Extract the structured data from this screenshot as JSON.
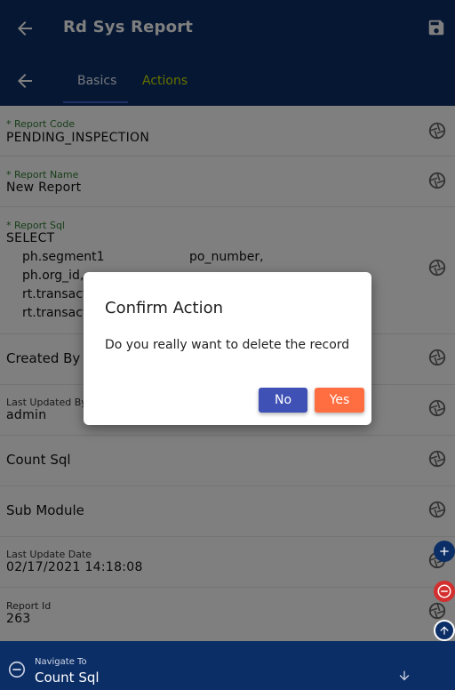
{
  "header": {
    "title": "Rd Sys Report",
    "back_icon": "arrow-left-icon",
    "save_icon": "save-icon"
  },
  "tabs": [
    {
      "label": "Basics",
      "active": true
    },
    {
      "label": "Actions",
      "active": false
    }
  ],
  "fields": {
    "report_code": {
      "label": "* Report Code",
      "value": "PENDING_INSPECTION"
    },
    "report_name": {
      "label": "* Report Name",
      "value": "New Report"
    },
    "report_sql": {
      "label": "* Report Sql",
      "first_line": "SELECT",
      "lines": [
        "ph.segment1",
        "ph.org_id,",
        "rt.transact",
        "rt.transact"
      ],
      "alias": "po_number,"
    },
    "created_by": {
      "label": "Created By"
    },
    "last_updated_by": {
      "label": "Last Updated By",
      "value": "admin"
    },
    "count_sql": {
      "label": "Count Sql"
    },
    "sub_module": {
      "label": "Sub Module"
    },
    "last_update_date": {
      "label": "Last Update Date",
      "value": "02/17/2021 14:18:08"
    },
    "report_id": {
      "label": "Report Id",
      "value": "263"
    }
  },
  "dialog": {
    "title": "Confirm Action",
    "message": "Do you really want to delete the record",
    "no_label": "No",
    "yes_label": "Yes"
  },
  "bottom_nav": {
    "label": "Navigate To",
    "value": "Count Sql"
  },
  "colors": {
    "primary": "#0c2e66",
    "accent": "#c8e000",
    "no_button": "#3f51b5",
    "yes_button": "#ff6e40",
    "required_label": "#2e7d32",
    "remove_fab": "#d32f2f"
  }
}
